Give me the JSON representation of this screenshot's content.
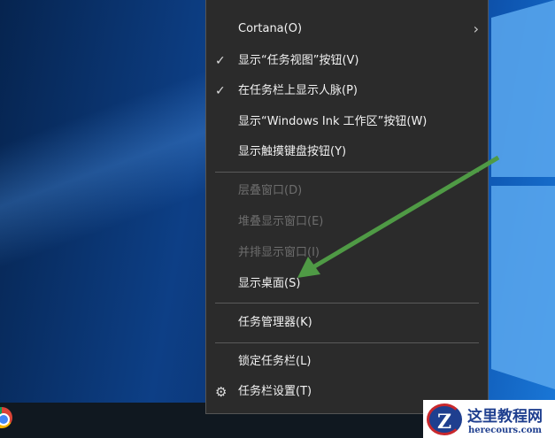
{
  "menu": {
    "items": [
      {
        "label": "Cortana(O)",
        "submenu": true
      },
      {
        "label": "显示“任务视图”按钮(V)",
        "checked": true
      },
      {
        "label": "在任务栏上显示人脉(P)",
        "checked": true
      },
      {
        "label": "显示“Windows Ink 工作区”按钮(W)"
      },
      {
        "label": "显示触摸键盘按钮(Y)"
      },
      {
        "label": "层叠窗口(D)",
        "disabled": true
      },
      {
        "label": "堆叠显示窗口(E)",
        "disabled": true
      },
      {
        "label": "并排显示窗口(I)",
        "disabled": true
      },
      {
        "label": "显示桌面(S)"
      },
      {
        "label": "任务管理器(K)"
      },
      {
        "label": "锁定任务栏(L)"
      },
      {
        "label": "任务栏设置(T)",
        "icon": "gear-icon"
      }
    ]
  },
  "annotation": {
    "arrow_color": "#4f9a45"
  },
  "watermark": {
    "title": "这里教程网",
    "url": "herecours.com"
  }
}
